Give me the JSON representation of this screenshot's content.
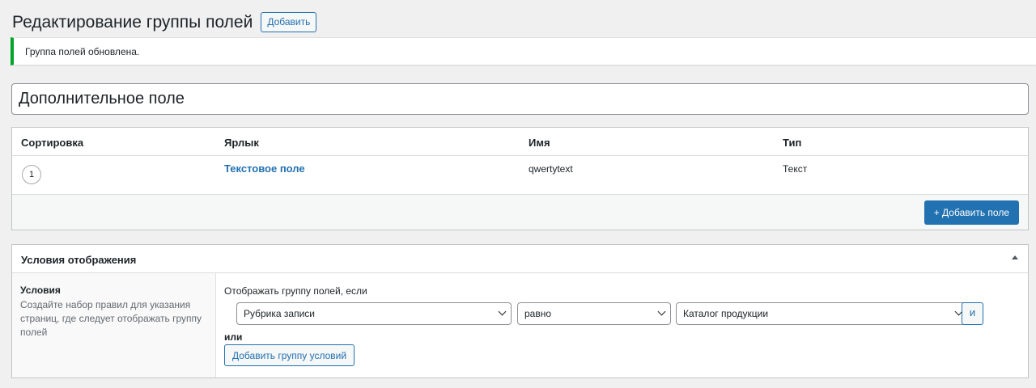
{
  "header": {
    "title": "Редактирование группы полей",
    "add_new_label": "Добавить"
  },
  "notice": {
    "text": "Группа полей обновлена.",
    "color": "#00a32a"
  },
  "title_input": {
    "value": "Дополнительное поле"
  },
  "fields_table": {
    "columns": [
      "Сортировка",
      "Ярлык",
      "Имя",
      "Тип"
    ],
    "rows": [
      {
        "order": "1",
        "label": "Текстовое поле",
        "name": "qwertytext",
        "type": "Текст"
      }
    ],
    "add_field_label": "+ Добавить поле"
  },
  "location": {
    "title": "Условия отображения",
    "collapse_icon": "triangle-up-icon",
    "rules_label": "Условия",
    "rules_desc": "Создайте набор правил для указания страниц, где следует отображать группу полей",
    "show_if_label": "Отображать группу полей, если",
    "rule": {
      "param": "Рубрика записи",
      "operator": "равно",
      "value": "Каталог продукции",
      "and_label": "и"
    },
    "or_label": "или",
    "add_group_label": "Добавить группу условий"
  },
  "colors": {
    "accent": "#2271b1",
    "background": "#f0f0f1"
  }
}
